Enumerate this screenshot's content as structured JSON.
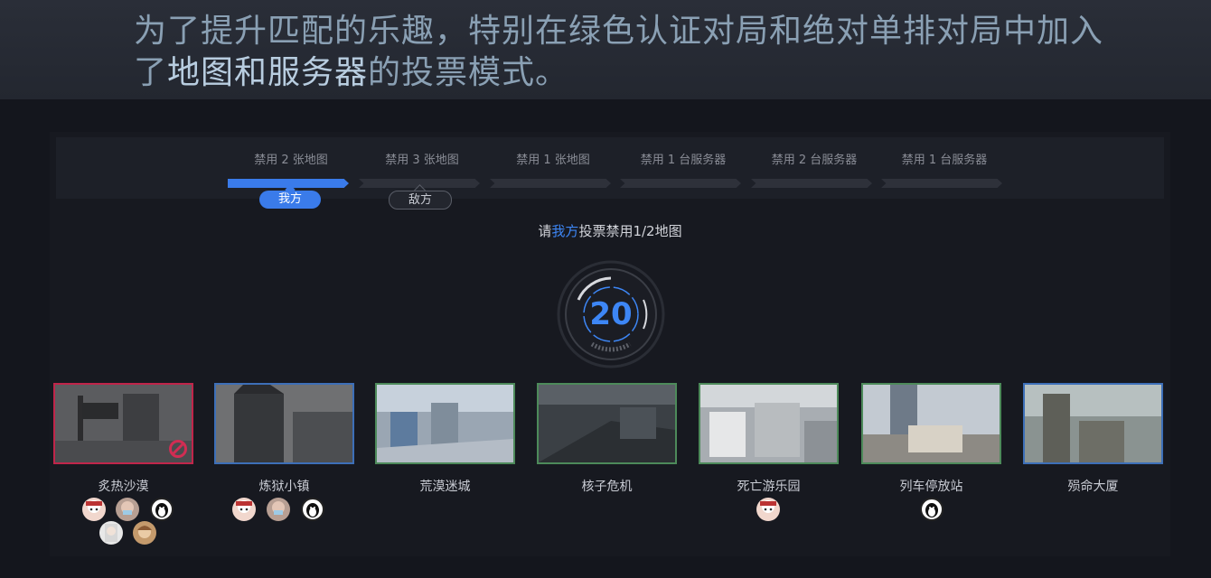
{
  "headline": {
    "line1": "为了提升匹配的乐趣，特别在绿色认证对局和绝对单排对局中加入",
    "line2_prefix": "了",
    "line2_highlight": "地图和服务器",
    "line2_suffix": "的投票模式。"
  },
  "steps": [
    {
      "label": "禁用 2 张地图",
      "active": true
    },
    {
      "label": "禁用 3 张地图",
      "active": false
    },
    {
      "label": "禁用 1 张地图",
      "active": false
    },
    {
      "label": "禁用 1 台服务器",
      "active": false
    },
    {
      "label": "禁用 2 台服务器",
      "active": false
    },
    {
      "label": "禁用 1 台服务器",
      "active": false
    }
  ],
  "sides": {
    "mine": "我方",
    "enemy": "敌方"
  },
  "prompt": {
    "prefix": "请",
    "side": "我方",
    "suffix": "投票禁用1/2地图"
  },
  "timer": {
    "value": "20"
  },
  "colors": {
    "accent": "#3a7bea",
    "banned": "#c0254a",
    "border_green": "#4d8a5a",
    "border_blue": "#3d6fb8"
  },
  "maps": [
    {
      "name": "炙热沙漠",
      "state": "banned",
      "votes": 5
    },
    {
      "name": "炼狱小镇",
      "state": "normal",
      "votes": 3
    },
    {
      "name": "荒漠迷城",
      "state": "normal",
      "votes": 0
    },
    {
      "name": "核子危机",
      "state": "normal",
      "votes": 0
    },
    {
      "name": "死亡游乐园",
      "state": "normal",
      "votes": 1
    },
    {
      "name": "列车停放站",
      "state": "normal",
      "votes": 1
    },
    {
      "name": "殒命大厦",
      "state": "normal",
      "votes": 0
    }
  ]
}
